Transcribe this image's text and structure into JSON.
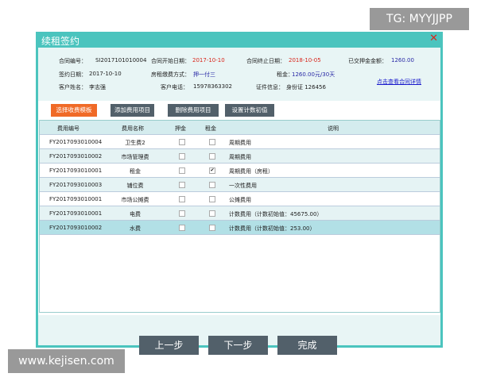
{
  "dialog": {
    "title": "续租签约",
    "close": "✕"
  },
  "info": {
    "contract_no_label": "合同编号：",
    "contract_no": "SI2017101010004",
    "start_label": "合同开始日期：",
    "start": "2017-10-10",
    "end_label": "合同终止日期：",
    "end": "2018-10-05",
    "deposit_label": "已交押金金额：",
    "deposit": "1260.00",
    "sign_label": "签约日期：",
    "sign": "2017-10-10",
    "pay_label": "房租缴费方式：",
    "pay": "押一付三",
    "rent_label": "租金：",
    "rent": "1260.00元/30天",
    "customer_label": "客户姓名：",
    "customer": "李志强",
    "phone_label": "客户电话：",
    "phone": "15978363302",
    "id_label": "证件信息：",
    "id": "身份证 126456",
    "detail_link": "点击查看合同详情"
  },
  "toolbar": {
    "select_template": "选择收费模板",
    "add": "添加费用项目",
    "delete": "删除费用项目",
    "set_initial": "设置计数初值"
  },
  "table": {
    "headers": [
      "费用编号",
      "费用名称",
      "押金",
      "租金",
      "说明"
    ],
    "rows": [
      {
        "code": "FY2017093010004",
        "name": "卫生费2",
        "deposit": false,
        "rent": false,
        "desc": "周期费用"
      },
      {
        "code": "FY2017093010002",
        "name": "市场管理费",
        "deposit": false,
        "rent": false,
        "desc": "周期费用"
      },
      {
        "code": "FY2017093010001",
        "name": "租金",
        "deposit": false,
        "rent": true,
        "desc": "周期费用（房租）"
      },
      {
        "code": "FY2017093010003",
        "name": "铺位费",
        "deposit": false,
        "rent": false,
        "desc": "一次性费用"
      },
      {
        "code": "FY2017093010001",
        "name": "市场公摊费",
        "deposit": false,
        "rent": false,
        "desc": "公摊费用"
      },
      {
        "code": "FY2017093010001",
        "name": "电费",
        "deposit": false,
        "rent": false,
        "desc": "计数费用（计数初始值：45675.00）"
      },
      {
        "code": "FY2017093010002",
        "name": "水费",
        "deposit": false,
        "rent": false,
        "desc": "计数费用（计数初始值：253.00）"
      }
    ]
  },
  "footer": {
    "prev": "上一步",
    "next": "下一步",
    "finish": "完成"
  },
  "watermarks": {
    "top": "TG: MYYJJPP",
    "bottom": "www.kejisen.com"
  }
}
